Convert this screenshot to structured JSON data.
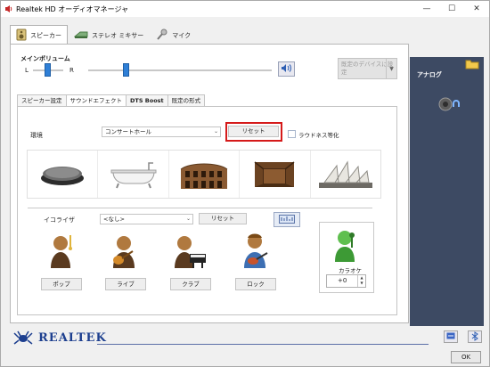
{
  "window": {
    "title": "Realtek HD オーディオマネージャ"
  },
  "device_tabs": [
    "スピーカー",
    "ステレオ ミキサー",
    "マイク"
  ],
  "volume": {
    "title": "メインボリューム",
    "left_label": "L",
    "right_label": "R"
  },
  "default_device": {
    "label": "既定のデバイスに設定"
  },
  "right_panel": {
    "label": "アナログ"
  },
  "sub_tabs": [
    "スピーカー設定",
    "サウンドエフェクト",
    "DTS Boost",
    "既定の形式"
  ],
  "environment": {
    "label": "環境",
    "selected": "コンサートホール",
    "reset_label": "リセット",
    "loudness_label": "ラウドネス等化"
  },
  "equalizer": {
    "label": "イコライザ",
    "selected": "<なし>",
    "reset_label": "リセット",
    "presets": [
      "ポップ",
      "ライブ",
      "クラブ",
      "ロック"
    ]
  },
  "karaoke": {
    "label": "カラオケ",
    "value": "+0"
  },
  "footer": {
    "brand": "REALTEK",
    "ok_label": "OK"
  },
  "colors": {
    "highlight": "#d51a1a",
    "accent": "#2f7fd6",
    "panel_dark": "#3d4a63",
    "brand": "#1d3f8f"
  }
}
